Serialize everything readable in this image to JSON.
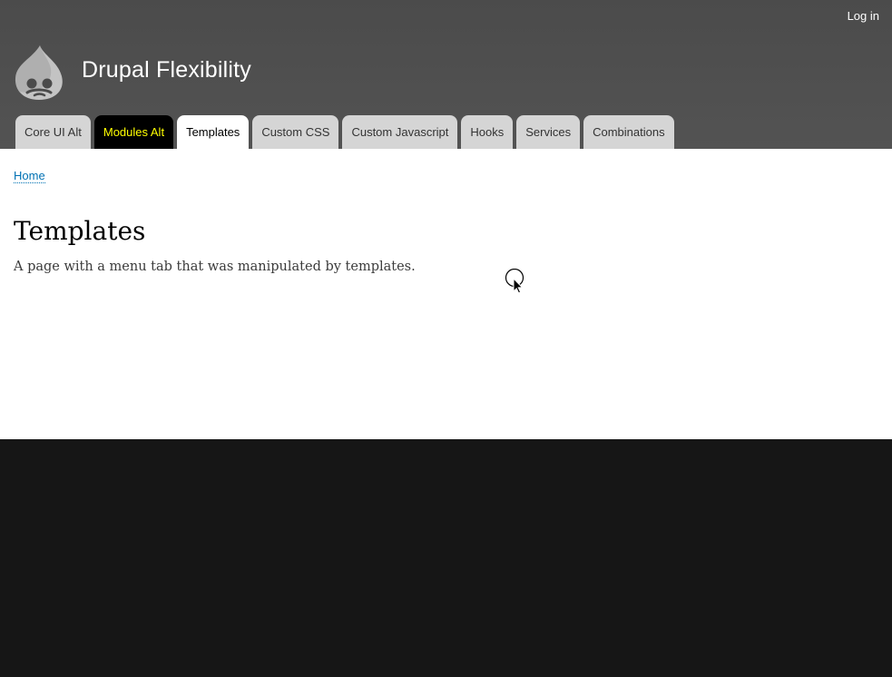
{
  "header": {
    "login_label": "Log in",
    "site_name": "Drupal Flexibility",
    "logo_icon": "drupal-drop-icon"
  },
  "nav": {
    "tabs": [
      {
        "label": "Core UI Alt"
      },
      {
        "label": "Modules Alt"
      },
      {
        "label": "Templates"
      },
      {
        "label": "Custom CSS"
      },
      {
        "label": "Custom Javascript"
      },
      {
        "label": "Hooks"
      },
      {
        "label": "Services"
      },
      {
        "label": "Combinations"
      }
    ]
  },
  "breadcrumb": {
    "home_label": "Home"
  },
  "content": {
    "title": "Templates",
    "body": "A page with a menu tab that was manipulated by templates."
  },
  "colors": {
    "header_bg": "#4b4b4b",
    "tab_bg": "#d5d5d5",
    "tab_special_bg": "#000000",
    "tab_special_text": "#ffff00",
    "link": "#0071b3",
    "footer_bg": "#161616"
  }
}
